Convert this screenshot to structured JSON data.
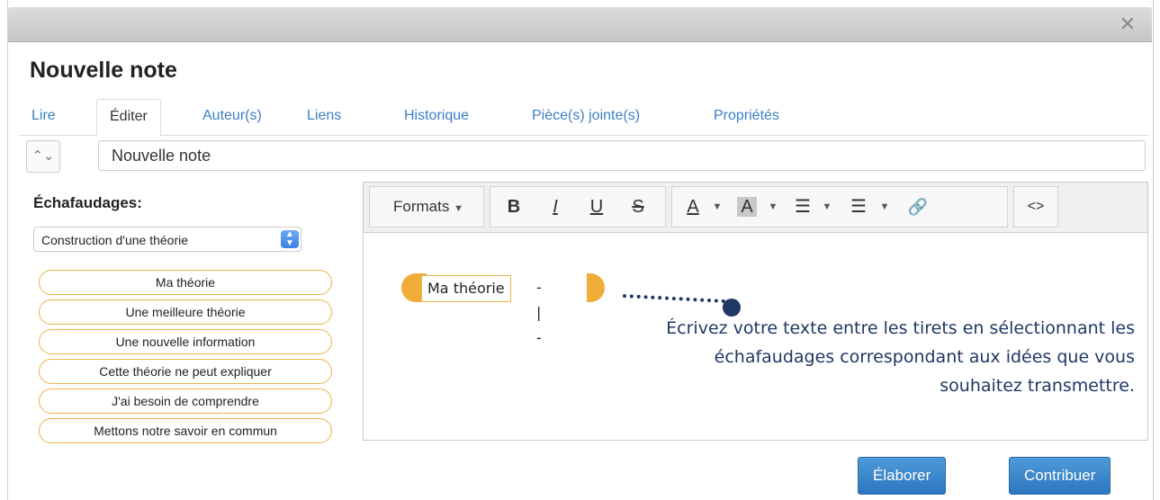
{
  "window": {
    "close_glyph": "✕"
  },
  "title": "Nouvelle note",
  "tabs": [
    {
      "label": "Lire"
    },
    {
      "label": "Éditer"
    },
    {
      "label": "Auteur(s)"
    },
    {
      "label": "Liens"
    },
    {
      "label": "Historique"
    },
    {
      "label": "Pièce(s) jointe(s)"
    },
    {
      "label": "Propriétés"
    }
  ],
  "title_input": {
    "value": "Nouvelle note"
  },
  "scaffolds": {
    "label": "Échafaudages:",
    "selected": "Construction d'une théorie",
    "items": [
      "Ma théorie",
      "Une meilleure théorie",
      "Une nouvelle information",
      "Cette théorie ne peut expliquer",
      "J'ai besoin de comprendre",
      "Mettons notre savoir en commun"
    ]
  },
  "toolbar": {
    "formats": "Formats",
    "bold": "B",
    "italic": "I",
    "underline": "U",
    "strike": "S",
    "text_color": "A",
    "bg_color": "A",
    "bullet_list_icon": "☰",
    "numbered_list_icon": "☰",
    "link_icon": "🔗",
    "code": "<>"
  },
  "editor": {
    "tag_label": "Ma théorie",
    "dashes": "- | -",
    "note": "Écrivez votre texte entre les tirets en sélectionnant les échafaudages correspondant aux idées que vous souhaitez transmettre."
  },
  "buttons": {
    "elaborer": "Élaborer",
    "contribuer": "Contribuer"
  },
  "colors": {
    "accent": "#3c7fc4",
    "scaffold_orange": "#f0ad3a",
    "note_navy": "#1f3864"
  }
}
